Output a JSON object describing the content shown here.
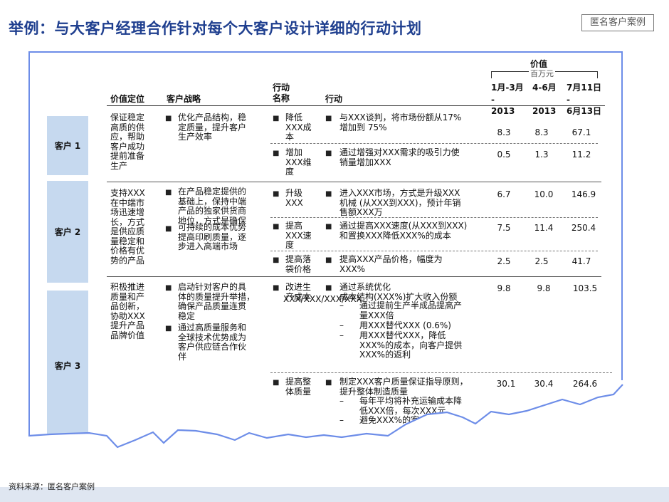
{
  "title": "举例：与大客户经理合作针对每个大客户设计详细的行动计划",
  "tag": "匿名客户案例",
  "source": "资料来源：匿名客户案例",
  "header": {
    "value_pos": "价值定位",
    "strategy": "客户战略",
    "action_name_1": "行动",
    "action_name_2": "名称",
    "action": "行动",
    "value": "价值",
    "unit": "百万元",
    "col1_a": "1月-3月",
    "col1_b": "-",
    "col1_c": "2013",
    "col2_a": "4-6月",
    "col2_c": "2013",
    "col3_a": "7月11日",
    "col3_b": "-",
    "col3_c": "6月13日"
  },
  "clients": [
    {
      "label": "客户 1",
      "value_pos": [
        "保证稳定",
        "高质的供",
        "应，帮助",
        "客户成功",
        "提前准备",
        "生产"
      ],
      "strategy": [
        [
          "优化产品结构，稳",
          "定质量，提升客户",
          "生产效率"
        ]
      ],
      "actions": [
        {
          "name": [
            "降低",
            "XXX成",
            "本"
          ],
          "detail": [
            [
              "与XXX谈判，将市场份额从17%",
              "增加到 75%"
            ]
          ],
          "v1": "8.3",
          "v2": "8.3",
          "v3": "67.1"
        },
        {
          "name": [
            "增加",
            "XXX维",
            "度"
          ],
          "detail": [
            [
              "通过增强对XXX需求的吸引力使",
              "销量增加XXX"
            ]
          ],
          "v1": "0.5",
          "v2": "1.3",
          "v3": "11.2"
        }
      ]
    },
    {
      "label": "客户 2",
      "value_pos": [
        "支持XXX",
        "在中端市",
        "场迅速增",
        "长，方式",
        "是供应质",
        "量稳定和",
        "价格有优",
        "势的产品"
      ],
      "strategy": [
        [
          "在产品稳定提供的",
          "基础上，保持中端",
          "产品的独家供货商",
          "地位，方式是确保"
        ],
        [
          "可持续的成本优势",
          "提高印刷质量，逐",
          "步进入高端市场"
        ]
      ],
      "actions": [
        {
          "name": [
            "升级",
            "XXX"
          ],
          "detail": [
            [
              "进入XXX市场，方式是升级XXX",
              "机械 (从XXX到XXX)，预计年销",
              "售额XXX万"
            ]
          ],
          "v1": "6.7",
          "v2": "10.0",
          "v3": "146.9"
        },
        {
          "name": [
            "提高",
            "XXX速",
            "度"
          ],
          "detail": [
            [
              "通过提高XXX速度(从XXX到XXX)",
              "和置换XXX降低XXX%的成本"
            ]
          ],
          "v1": "7.5",
          "v2": "11.4",
          "v3": "250.4"
        },
        {
          "name": [
            "提高落",
            "袋价格"
          ],
          "detail": [
            [
              "提高XXX产品价格，幅度为",
              "XXX%"
            ]
          ],
          "v1": "2.5",
          "v2": "2.5",
          "v3": "41.7"
        }
      ]
    },
    {
      "label": "客户 3",
      "value_pos": [
        "积极推进",
        "质量和产",
        "品创新，",
        "协助XXX",
        "提升产品",
        "品牌价值"
      ],
      "strategy": [
        [
          "启动针对客户的具",
          "体的质量提升举措，",
          "确保产品质量连贯",
          "稳定"
        ],
        [
          "通过高质量服务和",
          "全球技术优势成为",
          "客户供应链合作伙",
          "伴"
        ]
      ],
      "actions": [
        {
          "name": [
            "改进生",
            "产成本"
          ],
          "overlap": "XXX/XXX/XXX/XXX",
          "detail": [
            [
              "通过系统优化",
              "成本结构(XXX%)扩大收入份额"
            ]
          ],
          "sub": [
            [
              "通过提前生产半成品提高产",
              "量XXX倍"
            ],
            [
              "用XXX替代XXX (0.6%)"
            ],
            [
              "用XXX替代XXX，降低",
              "XXX%的成本，向客户提供",
              "XXX%的返利"
            ]
          ],
          "v1": "9.8",
          "v2": "9.8",
          "v3": "103.5"
        },
        {
          "name": [
            "提高整",
            "体质量"
          ],
          "detail": [
            [
              "制定XXX客户质量保证指导原则，",
              "提升整体制造质量"
            ]
          ],
          "sub": [
            [
              "每年平均将补充运输成本降",
              "低XXX倍，每次XXX元"
            ],
            [
              "避免XXX%的客户投诉，将"
            ]
          ],
          "v1": "30.1",
          "v2": "30.4",
          "v3": "264.6"
        }
      ]
    }
  ]
}
